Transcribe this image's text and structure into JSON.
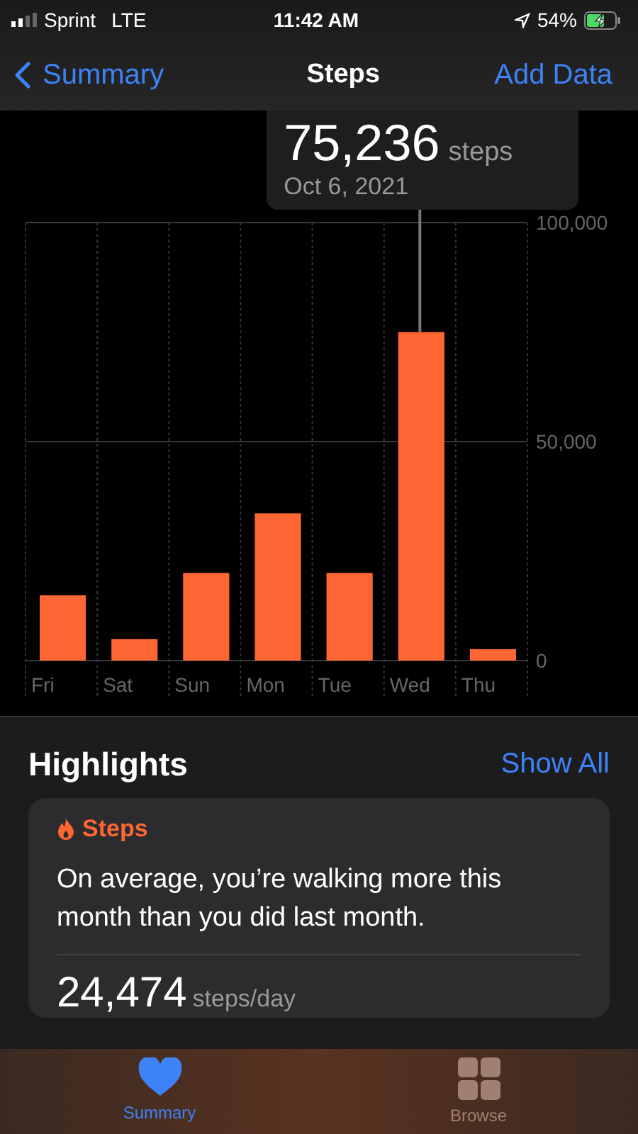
{
  "status_bar": {
    "carrier": "Sprint",
    "network": "LTE",
    "time": "11:42 AM",
    "battery": "54%"
  },
  "nav": {
    "back": "Summary",
    "title": "Steps",
    "action": "Add Data"
  },
  "chart": {
    "tooltip": {
      "value": "75,236",
      "unit": "steps",
      "date": "Oct 6, 2021"
    },
    "chart_data": {
      "type": "bar",
      "categories": [
        "Fri",
        "Sat",
        "Sun",
        "Mon",
        "Tue",
        "Wed",
        "Thu"
      ],
      "values": [
        14900,
        4900,
        20000,
        33600,
        20000,
        75000,
        2600
      ],
      "ylim": [
        0,
        100000
      ],
      "yticks": [
        {
          "value": 0,
          "label": "0"
        },
        {
          "value": 50000,
          "label": "50,000"
        },
        {
          "value": 100000,
          "label": "100,000"
        }
      ]
    }
  },
  "highlights": {
    "title": "Highlights",
    "show_all": "Show All",
    "card": {
      "category": "Steps",
      "text": "On average, you’re walking more this month than you did last month.",
      "stat_value": "24,474",
      "stat_unit": "steps/day"
    }
  },
  "tabs": [
    {
      "label": "Summary",
      "selected": true,
      "kind": "heart"
    },
    {
      "label": "Browse",
      "selected": false,
      "kind": "grid"
    }
  ]
}
